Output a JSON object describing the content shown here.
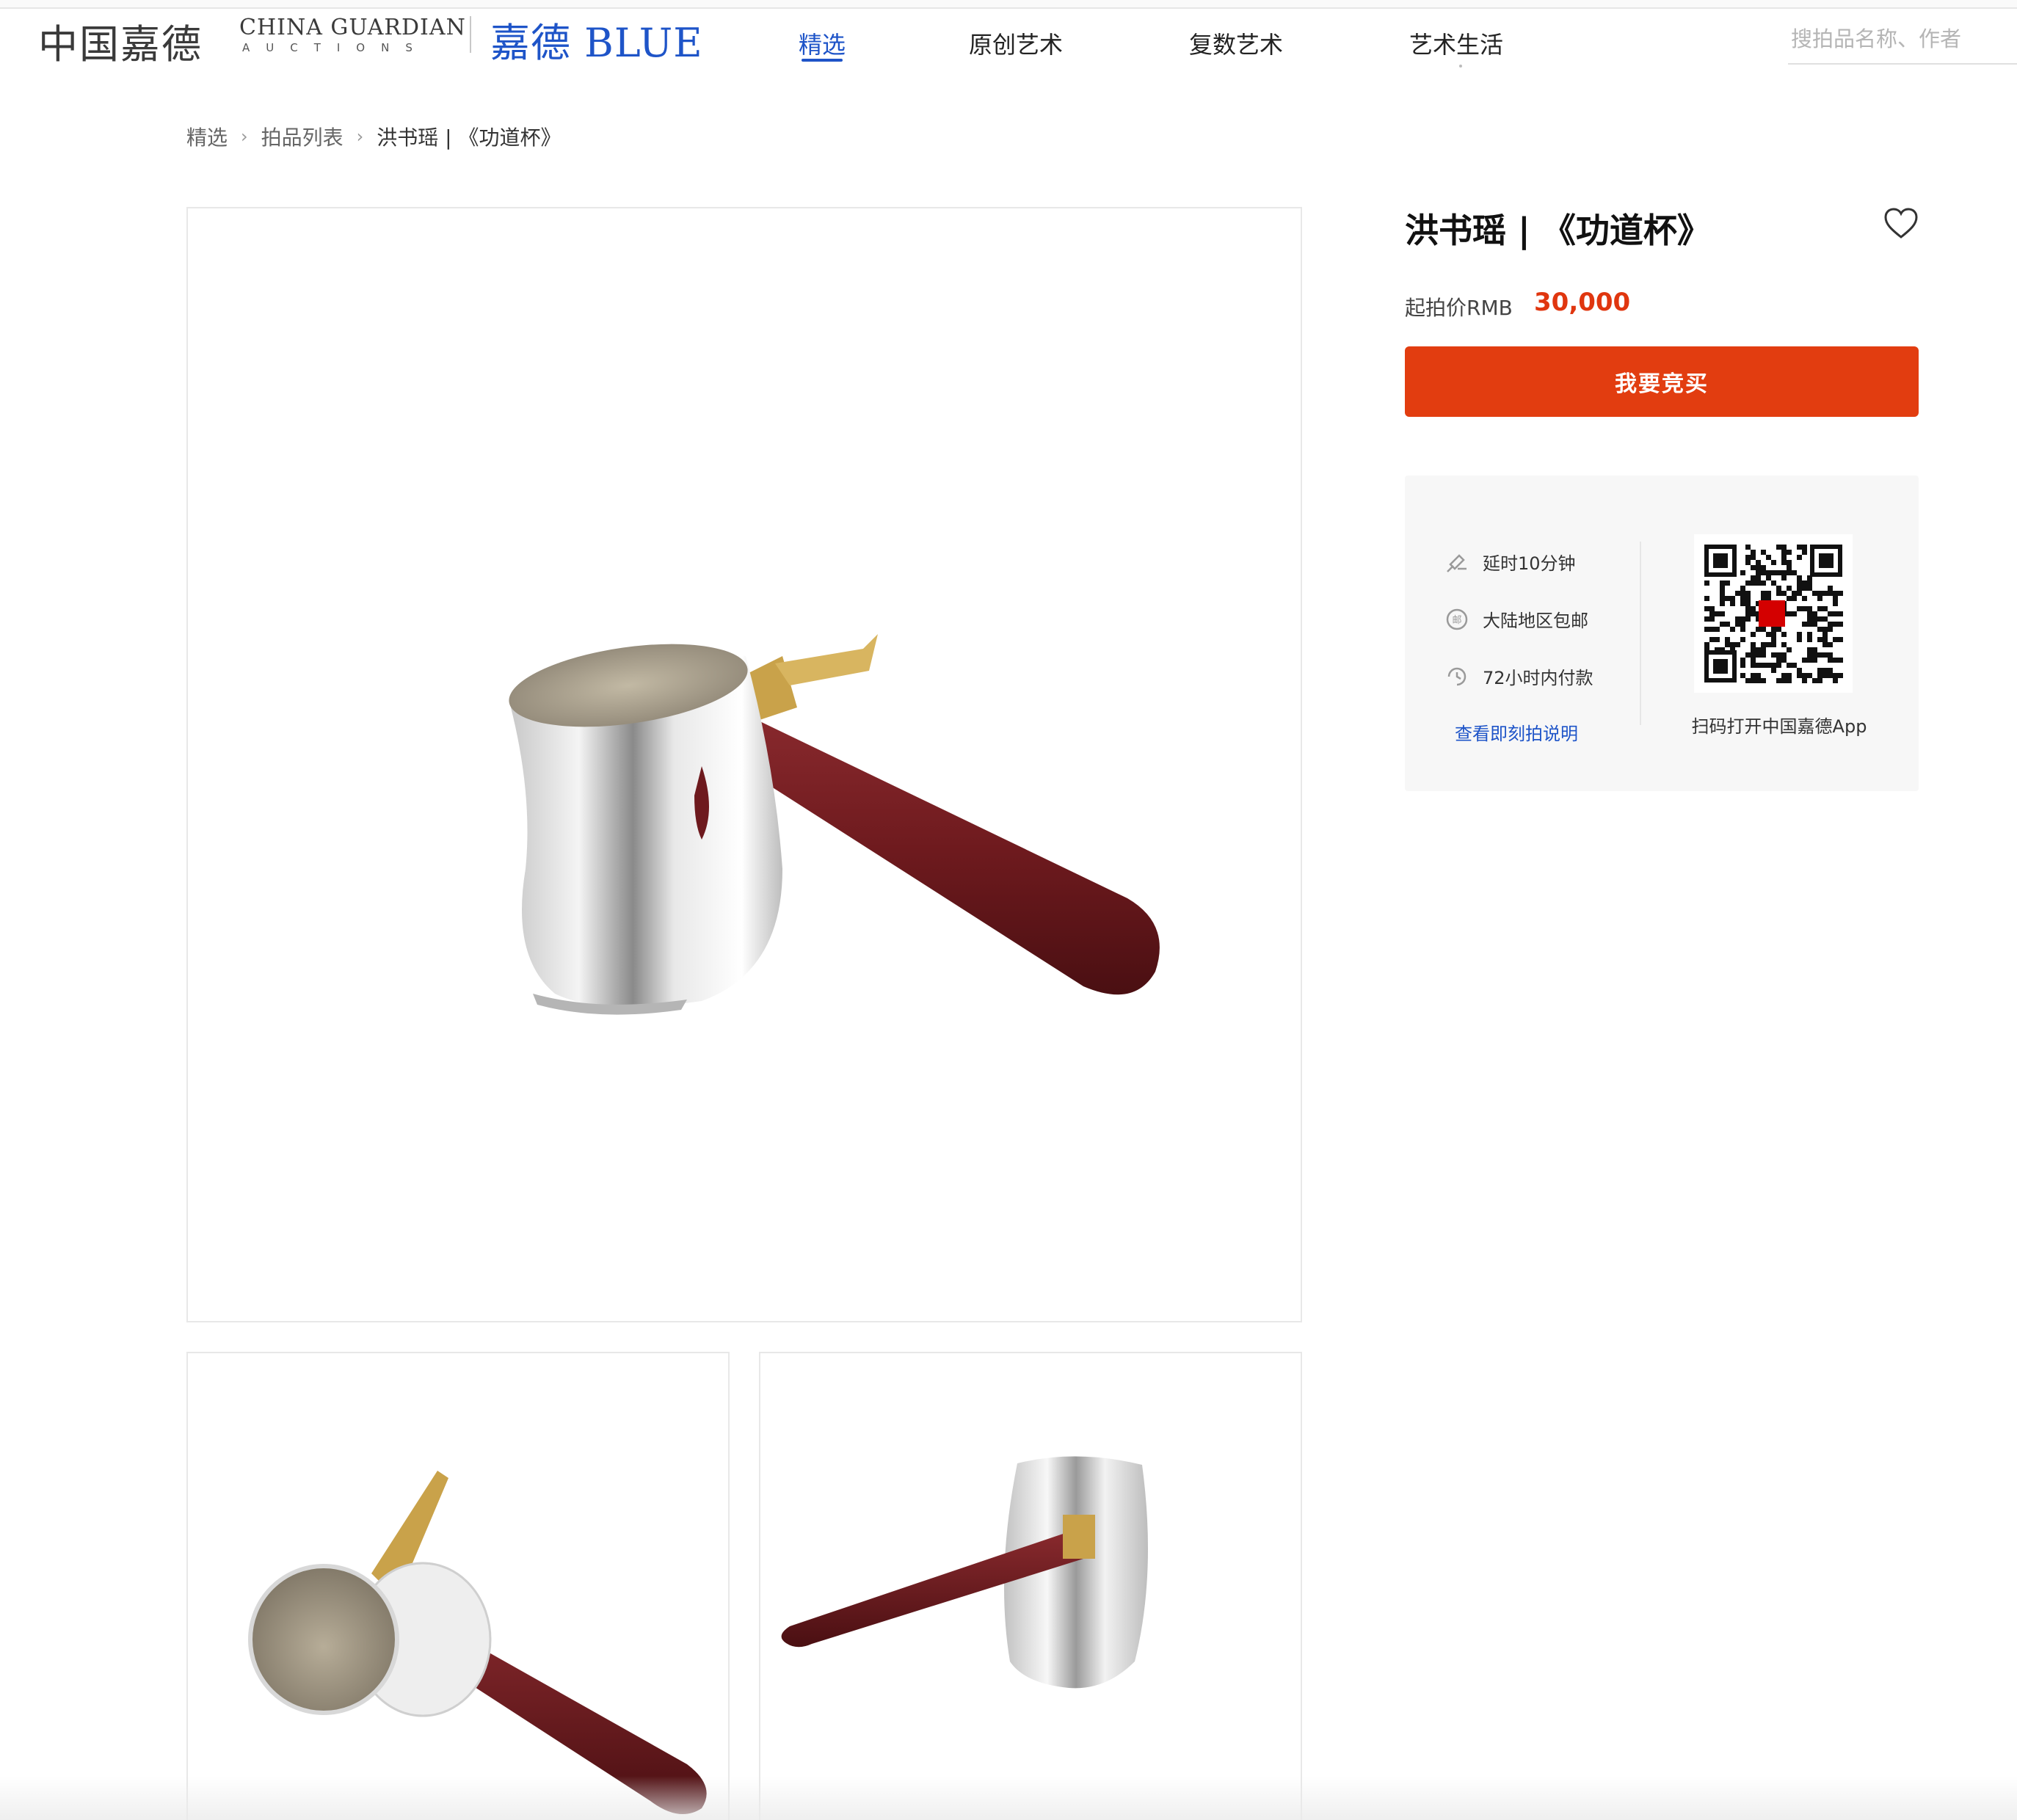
{
  "header": {
    "logo_cn": "中国嘉德",
    "logo_en": "CHINA GUARDIAN",
    "logo_en_sub": "AUCTIONS",
    "logo_blue": "嘉德 BLUE",
    "nav": [
      {
        "label": "精选",
        "active": true
      },
      {
        "label": "原创艺术",
        "active": false
      },
      {
        "label": "复数艺术",
        "active": false
      },
      {
        "label": "艺术生活",
        "active": false
      }
    ],
    "search_placeholder": "搜拍品名称、作者"
  },
  "breadcrumb": [
    "精选",
    "拍品列表",
    "洪书瑶 | 《功道杯》"
  ],
  "item": {
    "title": "洪书瑶 | 《功道杯》",
    "price_label": "起拍价RMB",
    "price_value": "30,000",
    "bid_button": "我要竞买"
  },
  "info": {
    "rows": [
      {
        "icon": "gavel-icon",
        "text": "延时10分钟"
      },
      {
        "icon": "shipping-icon",
        "text": "大陆地区包邮"
      },
      {
        "icon": "clock-72-icon",
        "text": "72小时内付款"
      }
    ],
    "link": "查看即刻拍说明",
    "qr_caption": "扫码打开中国嘉德App"
  },
  "colors": {
    "brand_blue": "#1e54c8",
    "accent_red": "#e23d10",
    "price_red": "#e0360f",
    "handle_wood": "#6e1a1e",
    "silver": "#d9d9d9",
    "brass": "#c9a24a"
  }
}
